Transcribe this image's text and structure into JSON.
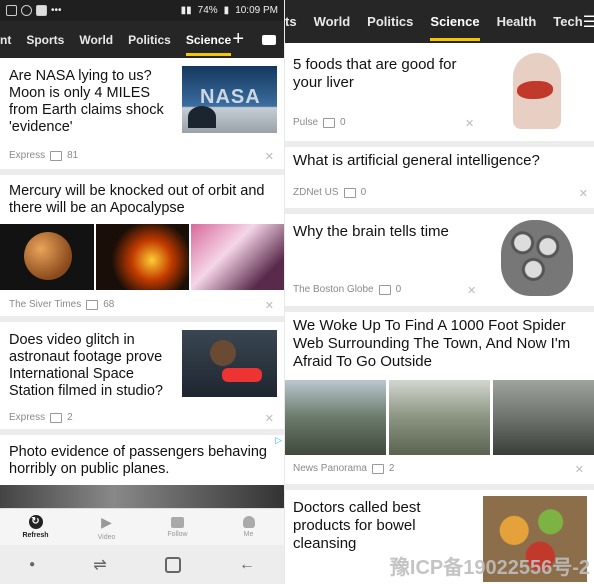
{
  "left": {
    "status": {
      "battery": "74%",
      "time": "10:09 PM"
    },
    "nav": {
      "tabs": [
        "nt",
        "Sports",
        "World",
        "Politics",
        "Science"
      ],
      "active": "Science",
      "add_label": "+"
    },
    "cards": [
      {
        "title": "Are NASA lying to us? Moon is only 4 MILES from Earth claims shock 'evidence'",
        "source": "Express",
        "comments": "81",
        "image_text": "NASA"
      },
      {
        "title": "Mercury will be knocked out of orbit and there will be an Apocalypse",
        "source": "The Siver Times",
        "comments": "68"
      },
      {
        "title": "Does video glitch in astronaut footage prove International Space Station filmed in studio?",
        "source": "Express",
        "comments": "2"
      },
      {
        "title": "Photo evidence of passengers behaving horribly on public planes.",
        "ad_label": "▷"
      }
    ],
    "bottom_nav": [
      "Refresh",
      "Video",
      "Follow",
      "Me"
    ]
  },
  "right": {
    "nav": {
      "tabs": [
        "ts",
        "World",
        "Politics",
        "Science",
        "Health",
        "Tech"
      ],
      "active": "Science"
    },
    "cards": [
      {
        "title": "5 foods that are good for your liver",
        "source": "Pulse",
        "comments": "0"
      },
      {
        "title": "What is artificial general intelligence?",
        "source": "ZDNet US",
        "comments": "0"
      },
      {
        "title": "Why the brain tells time",
        "source": "The Boston Globe",
        "comments": "0"
      },
      {
        "title": "We Woke Up To Find A 1000 Foot Spider Web Surrounding The Town, And Now I'm Afraid To Go Outside",
        "source": "News Panorama",
        "comments": "2"
      },
      {
        "title": "Doctors called best products for bowel cleansing"
      }
    ]
  },
  "watermark": "豫ICP备19022556号-2",
  "colors": {
    "accent": "#f6c700",
    "navbar": "#262626"
  }
}
